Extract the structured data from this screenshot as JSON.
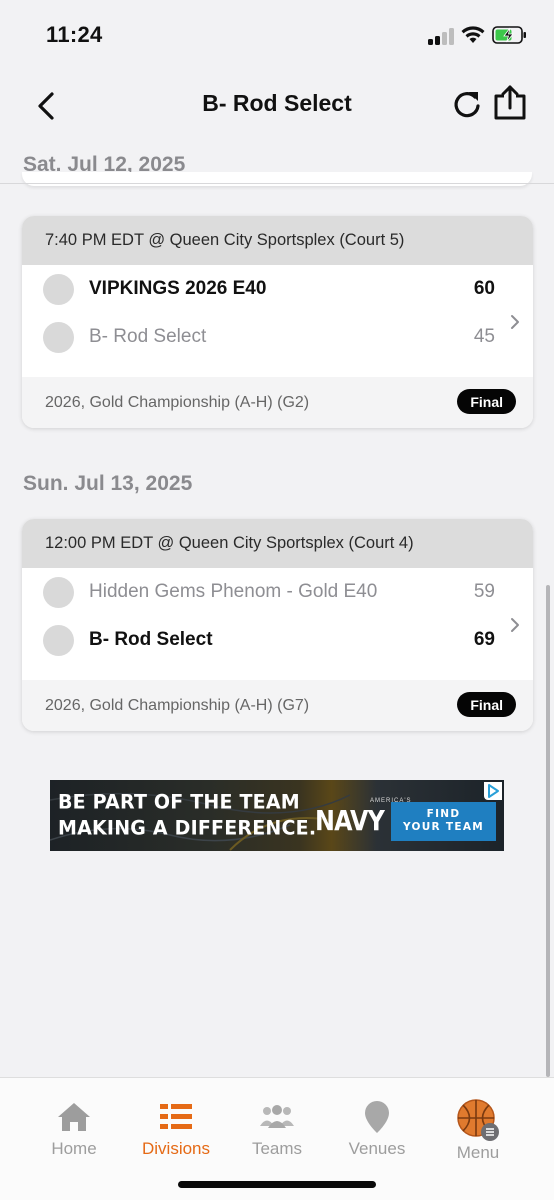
{
  "status_bar": {
    "time": "11:24"
  },
  "nav": {
    "title": "B- Rod Select"
  },
  "schedule": [
    {
      "date": "Sat. Jul 12, 2025",
      "game": {
        "header": "7:40 PM EDT @ Queen City Sportsplex (Court 5)",
        "teams": [
          {
            "name": "VIPKINGS 2026 E40",
            "score": "60",
            "winner": true
          },
          {
            "name": "B- Rod Select",
            "score": "45",
            "winner": false
          }
        ],
        "bracket": "2026, Gold Championship (A-H) (G2)",
        "status": "Final"
      }
    },
    {
      "date": "Sun. Jul 13, 2025",
      "game": {
        "header": "12:00 PM EDT @ Queen City Sportsplex (Court 4)",
        "teams": [
          {
            "name": "Hidden Gems Phenom - Gold E40",
            "score": "59",
            "winner": false
          },
          {
            "name": "B- Rod Select",
            "score": "69",
            "winner": true
          }
        ],
        "bracket": "2026, Gold Championship (A-H) (G7)",
        "status": "Final"
      }
    }
  ],
  "ad": {
    "line1": "BE PART OF THE TEAM",
    "line2": "MAKING A DIFFERENCE.",
    "brand_small": "AMERICA'S",
    "brand": "NAVY",
    "cta_line1": "FIND",
    "cta_line2": "YOUR TEAM"
  },
  "tabbar": {
    "items": [
      {
        "label": "Home",
        "icon": "home-icon",
        "active": false
      },
      {
        "label": "Divisions",
        "icon": "list-icon",
        "active": true
      },
      {
        "label": "Teams",
        "icon": "people-icon",
        "active": false
      },
      {
        "label": "Venues",
        "icon": "location-pin-icon",
        "active": false
      },
      {
        "label": "Menu",
        "icon": "basketball-menu-icon",
        "active": false
      }
    ]
  },
  "colors": {
    "accent": "#e56a16",
    "badge": "#050505",
    "card_header": "#dcdcdc",
    "background": "#f2f2f4"
  }
}
